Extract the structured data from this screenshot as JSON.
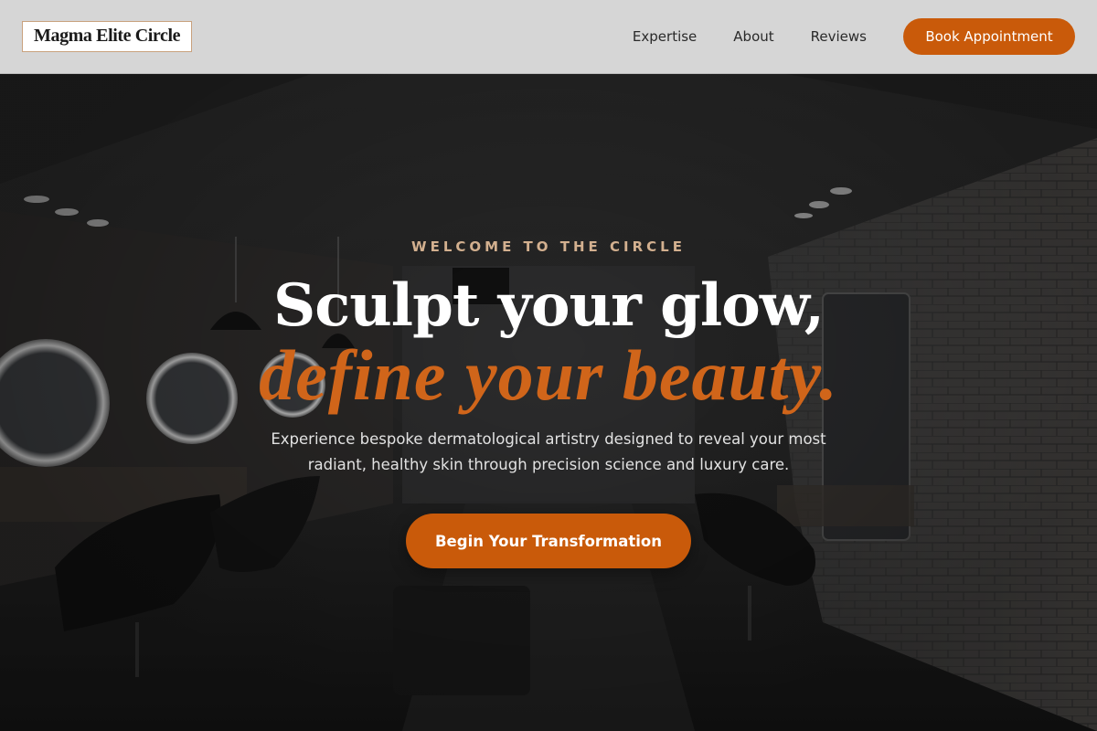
{
  "brand": {
    "name": "Magma Elite Circle"
  },
  "nav": {
    "links": [
      "Expertise",
      "About",
      "Reviews"
    ],
    "cta_label": "Book Appointment"
  },
  "hero": {
    "eyebrow": "WELCOME TO THE CIRCLE",
    "headline_line1": "Sculpt your glow,",
    "headline_line2": "define your beauty.",
    "subtext": "Experience bespoke dermatological artistry designed to reveal your most radiant, healthy skin through precision science and luxury care.",
    "cta_label": "Begin Your Transformation"
  },
  "colors": {
    "accent": "#c95a0a",
    "accent_text": "#d0651a",
    "eyebrow": "#d3b08f",
    "header_bg": "#d6d6d6"
  }
}
